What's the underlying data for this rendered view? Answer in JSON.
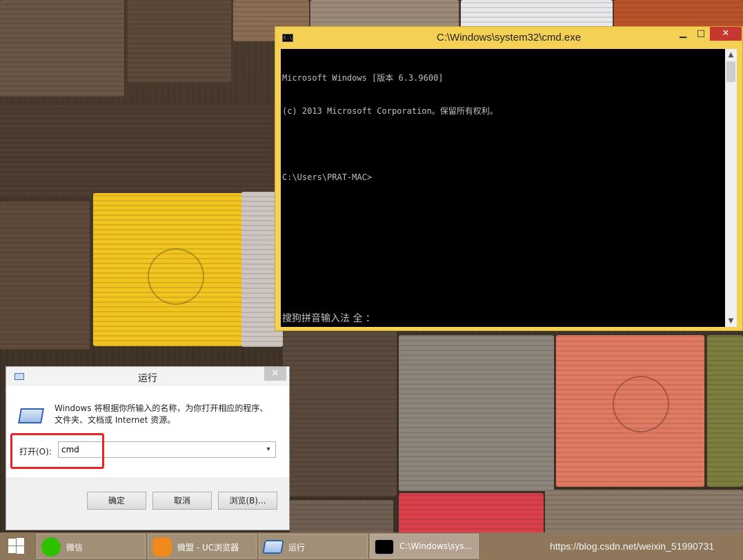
{
  "cmd_window": {
    "title": "C:\\Windows\\system32\\cmd.exe",
    "icon_text": "C:\\",
    "minimize": "▁",
    "maximize": "□",
    "close": "✕",
    "console_lines": [
      "Microsoft Windows [版本 6.3.9600]",
      "(c) 2013 Microsoft Corporation。保留所有权利。",
      "",
      "C:\\Users\\PRAT-MAC>"
    ],
    "ime_status": "搜狗拼音输入法 全 ：",
    "scroll_up": "▲",
    "scroll_down": "▼"
  },
  "run_dialog": {
    "title": "运行",
    "close": "✕",
    "description": "Windows 将根据你所输入的名称，为你打开相应的程序、文件夹、文档或 Internet 资源。",
    "open_label": "打开(O):",
    "input_value": "cmd",
    "dropdown": "▾",
    "ok": "确定",
    "cancel": "取消",
    "browse": "浏览(B)..."
  },
  "taskbar": {
    "items": [
      {
        "label": "微信",
        "icon": "wechat-icon",
        "color": "#2dc100"
      },
      {
        "label": "微盟 - UC浏览器",
        "icon": "uc-browser-icon",
        "color": "#f08a1c"
      },
      {
        "label": "运行",
        "icon": "run-icon",
        "color": "#2f63ad"
      },
      {
        "label": "C:\\Windows\\sys...",
        "icon": "cmd-icon",
        "color": "#000000"
      }
    ],
    "watermark": "https://blog.csdn.net/weixin_51990731"
  },
  "colors": {
    "cmd_frame": "#f4d154",
    "highlight": "#ee2222",
    "close_red": "#c7372f"
  }
}
